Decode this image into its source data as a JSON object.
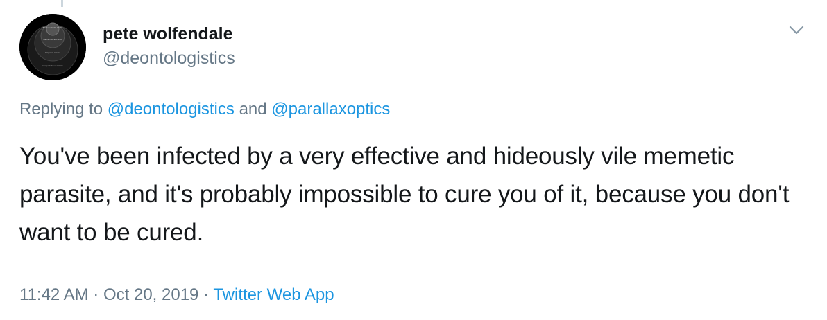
{
  "author": {
    "display_name": "pete wolfendale",
    "handle": "@deontologistics",
    "avatar_labels": [
      "Transcendental Claims",
      "Mathematical Claims",
      "Empirical Claims",
      "Interpretational Claims"
    ]
  },
  "reply_context": {
    "prefix": "Replying to",
    "mention_1": "@deontologistics",
    "conjunction": "and",
    "mention_2": "@parallaxoptics"
  },
  "tweet": {
    "text": "You've been infected by a very effective and hideously vile memetic parasite, and it's probably impossible to cure you of it, because you don't want to be cured."
  },
  "meta": {
    "time": "11:42 AM",
    "separator": "·",
    "date": "Oct 20, 2019",
    "source": "Twitter Web App"
  },
  "icons": {
    "menu": "chevron-down-icon"
  },
  "colors": {
    "link": "#1b95e0",
    "secondary_text": "#657786",
    "primary_text": "#14171a"
  }
}
